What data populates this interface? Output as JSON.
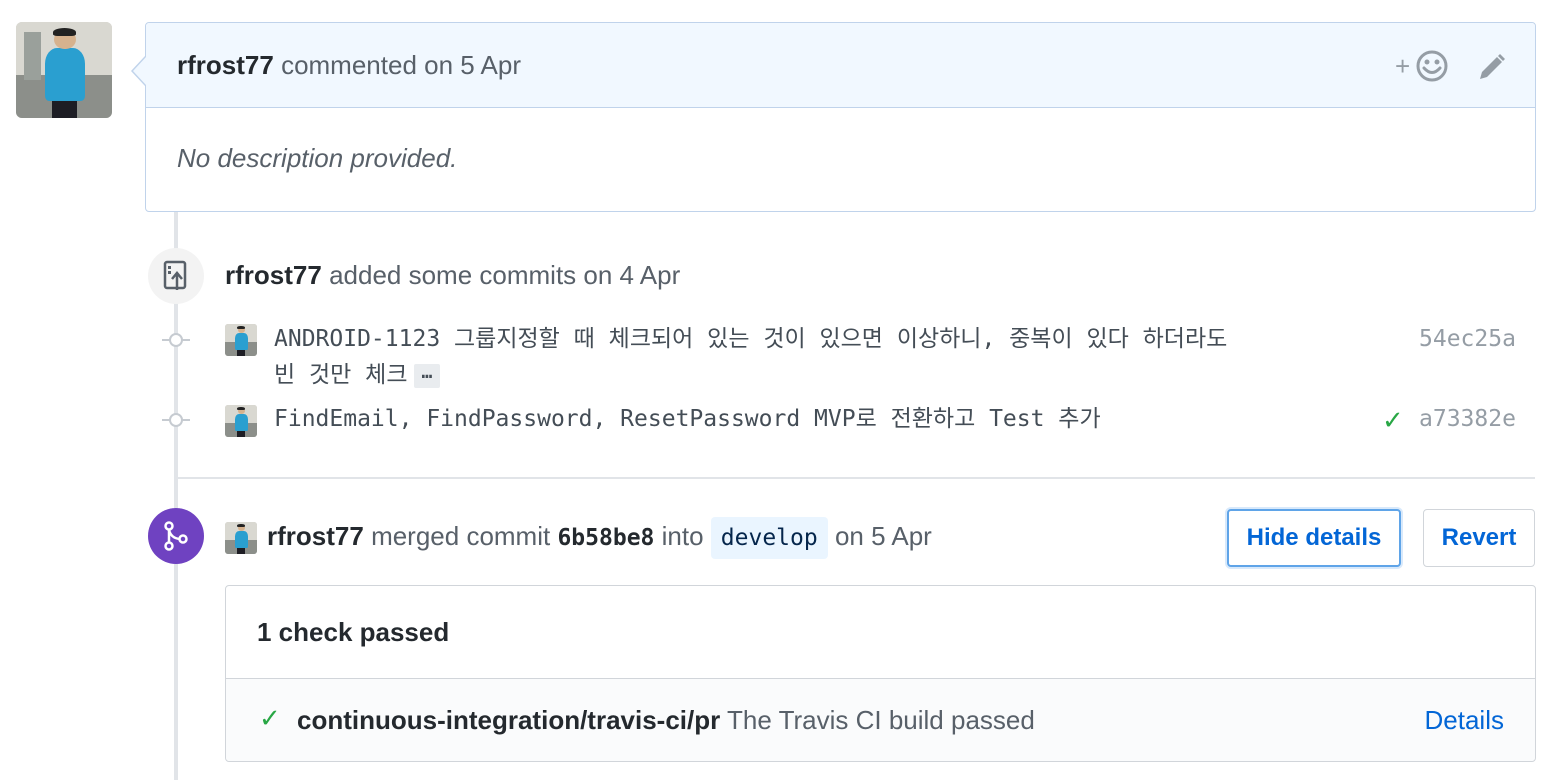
{
  "comment": {
    "author": "rfrost77",
    "action": "commented on 5 Apr",
    "body": "No description provided.",
    "reaction_label": "+"
  },
  "commits_event": {
    "author": "rfrost77",
    "action": "added some commits on 4 Apr",
    "commits": [
      {
        "message_line1": "ANDROID-1123 그룹지정할 때 체크되어 있는 것이 있으면 이상하니, 중복이 있다 하더라도",
        "message_line2": "빈 것만 체크",
        "expand_label": "…",
        "sha": "54ec25a",
        "status": ""
      },
      {
        "message_line1": "FindEmail, FindPassword, ResetPassword MVP로 전환하고 Test 추가",
        "sha": "a73382e",
        "status": "✓"
      }
    ]
  },
  "merge_event": {
    "author": "rfrost77",
    "action": "merged commit",
    "commit_sha": "6b58be8",
    "into": "into",
    "branch": "develop",
    "date": "on 5 Apr",
    "hide_details_label": "Hide details",
    "revert_label": "Revert"
  },
  "checks": {
    "summary": "1 check passed",
    "items": [
      {
        "status": "✓",
        "context": "continuous-integration/travis-ci/pr",
        "description": "The Travis CI build passed",
        "details_label": "Details"
      }
    ]
  },
  "colors": {
    "merged_purple": "#6f42c1",
    "success_green": "#28a745",
    "link_blue": "#0366d6",
    "header_bg": "#f1f8ff"
  }
}
